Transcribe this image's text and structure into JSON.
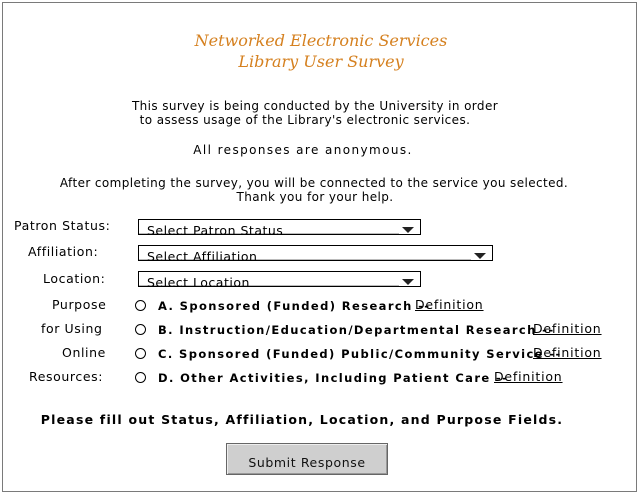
{
  "header": {
    "title_line1": "Networked Electronic Services",
    "title_line2": "Library User Survey"
  },
  "intro": {
    "line1": "This survey is being conducted by the University in order",
    "line2": "to assess usage of the Library's electronic services.",
    "anonymous": "All responses are anonymous.",
    "after_line1": "After completing the survey, you will be connected to the service you selected.",
    "after_line2": "Thank you for your help."
  },
  "form": {
    "status": {
      "label": "Patron Status:",
      "value": "Select Patron Status"
    },
    "affiliation": {
      "label": "Affiliation:",
      "value": "Select Affiliation"
    },
    "location": {
      "label": "Location:",
      "value": "Select Location"
    },
    "purpose_labels": [
      "Purpose",
      "for Using",
      "Online",
      "Resources:"
    ],
    "purpose_options": [
      {
        "text": "A. Sponsored (Funded) Research --",
        "link": "Definition"
      },
      {
        "text": "B. Instruction/Education/Departmental Research --",
        "link": "Definition"
      },
      {
        "text": "C. Sponsored (Funded) Public/Community Service --",
        "link": "Definition"
      },
      {
        "text": "D. Other Activities, Including Patient Care --",
        "link": "Definition"
      }
    ],
    "notice": "Please fill out Status, Affiliation, Location, and Purpose Fields.",
    "submit_label": "Submit Response"
  },
  "icons": {
    "dropdown": "chevron-down-icon",
    "radio": "radio-unchecked-icon"
  }
}
